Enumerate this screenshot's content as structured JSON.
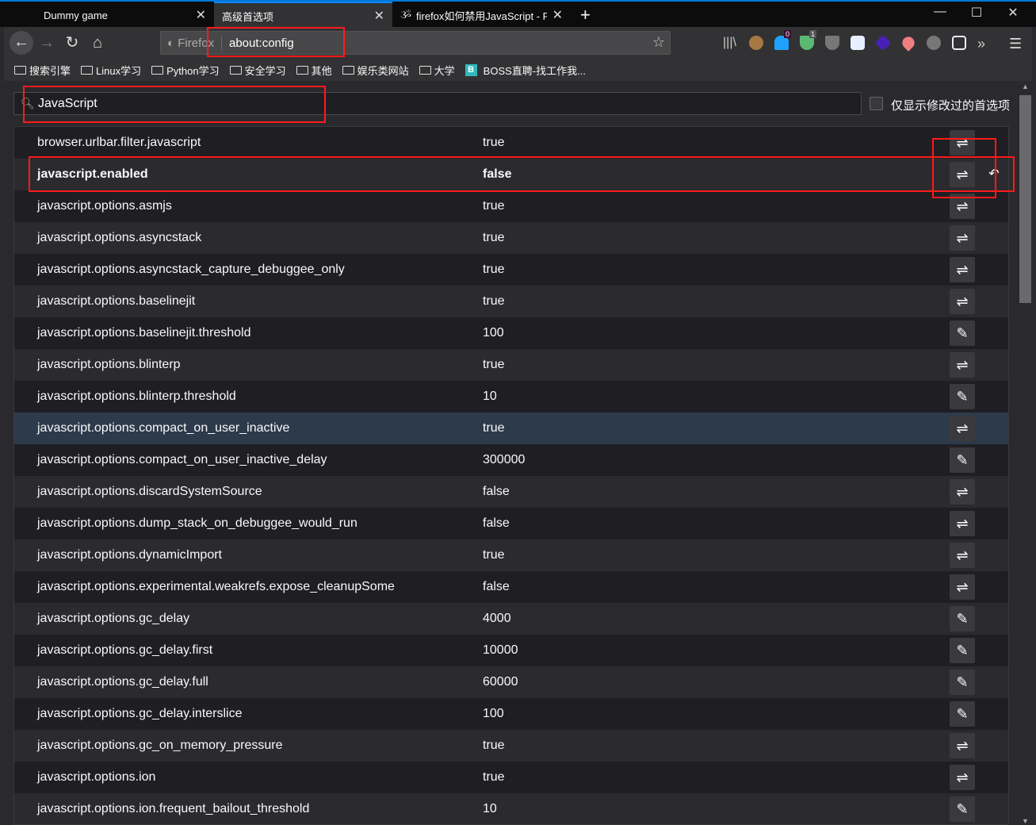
{
  "tabs": [
    {
      "label": "Dummy game"
    },
    {
      "label": "高级首选项",
      "active": true
    },
    {
      "label": "firefox如何禁用JavaScript - PH"
    }
  ],
  "toolbar": {
    "identity": "Firefox",
    "url": "about:config",
    "badges": {
      "ghost": "0",
      "shield": "1"
    }
  },
  "bookmarks": [
    "搜索引擎",
    "Linux学习",
    "Python学习",
    "安全学习",
    "其他",
    "娱乐类网站",
    "大学"
  ],
  "bookmark_site": {
    "icon": "B",
    "label": "BOSS直聘-找工作我..."
  },
  "search": {
    "value": "JavaScript"
  },
  "modified_only_label": "仅显示修改过的首选项",
  "prefs": [
    {
      "name": "browser.urlbar.filter.javascript",
      "value": "true",
      "action": "toggle"
    },
    {
      "name": "javascript.enabled",
      "value": "false",
      "action": "toggle",
      "modified": true
    },
    {
      "name": "javascript.options.asmjs",
      "value": "true",
      "action": "toggle"
    },
    {
      "name": "javascript.options.asyncstack",
      "value": "true",
      "action": "toggle"
    },
    {
      "name": "javascript.options.asyncstack_capture_debuggee_only",
      "value": "true",
      "action": "toggle"
    },
    {
      "name": "javascript.options.baselinejit",
      "value": "true",
      "action": "toggle"
    },
    {
      "name": "javascript.options.baselinejit.threshold",
      "value": "100",
      "action": "edit"
    },
    {
      "name": "javascript.options.blinterp",
      "value": "true",
      "action": "toggle"
    },
    {
      "name": "javascript.options.blinterp.threshold",
      "value": "10",
      "action": "edit"
    },
    {
      "name": "javascript.options.compact_on_user_inactive",
      "value": "true",
      "action": "toggle",
      "highlighted": true
    },
    {
      "name": "javascript.options.compact_on_user_inactive_delay",
      "value": "300000",
      "action": "edit"
    },
    {
      "name": "javascript.options.discardSystemSource",
      "value": "false",
      "action": "toggle"
    },
    {
      "name": "javascript.options.dump_stack_on_debuggee_would_run",
      "value": "false",
      "action": "toggle"
    },
    {
      "name": "javascript.options.dynamicImport",
      "value": "true",
      "action": "toggle"
    },
    {
      "name": "javascript.options.experimental.weakrefs.expose_cleanupSome",
      "value": "false",
      "action": "toggle"
    },
    {
      "name": "javascript.options.gc_delay",
      "value": "4000",
      "action": "edit"
    },
    {
      "name": "javascript.options.gc_delay.first",
      "value": "10000",
      "action": "edit"
    },
    {
      "name": "javascript.options.gc_delay.full",
      "value": "60000",
      "action": "edit"
    },
    {
      "name": "javascript.options.gc_delay.interslice",
      "value": "100",
      "action": "edit"
    },
    {
      "name": "javascript.options.gc_on_memory_pressure",
      "value": "true",
      "action": "toggle"
    },
    {
      "name": "javascript.options.ion",
      "value": "true",
      "action": "toggle"
    },
    {
      "name": "javascript.options.ion.frequent_bailout_threshold",
      "value": "10",
      "action": "edit"
    }
  ],
  "colors": {
    "accent": "#0a84ff",
    "annotation": "#ff1a1a",
    "highlight_row": "#2d3a4b"
  }
}
